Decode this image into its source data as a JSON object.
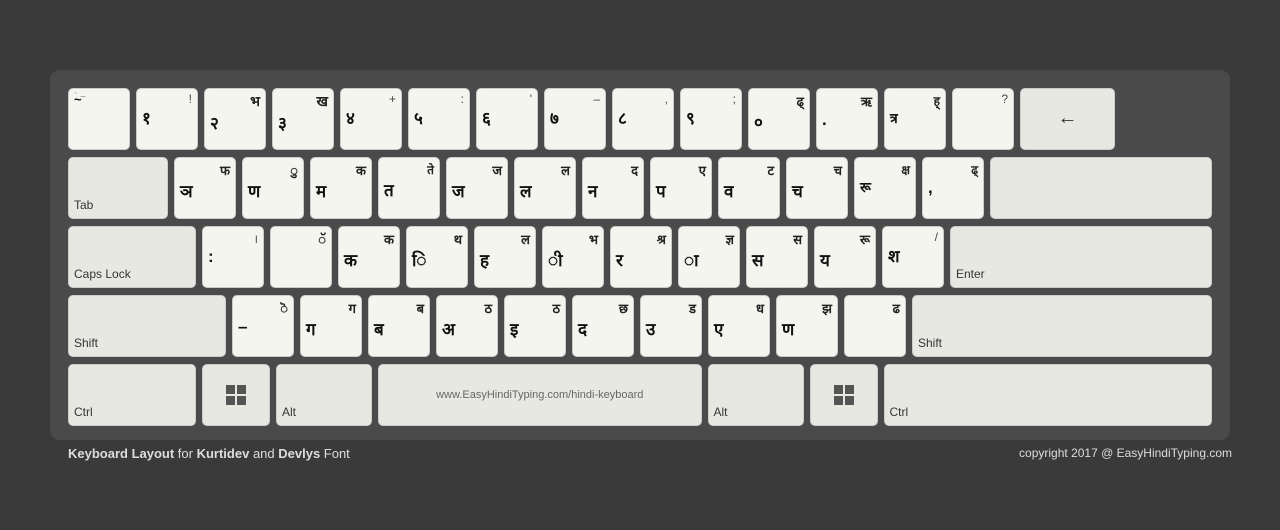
{
  "keyboard": {
    "title": "Keyboard Layout",
    "subtitle_for": "for",
    "font1": "Kurtidev",
    "and": "and",
    "font2": "Devlys",
    "font_label": "Font",
    "copyright": "copyright 2017 @ EasyHindiTyping.com",
    "space_label": "www.EasyHindiTyping.com/hindi-keyboard",
    "rows": [
      {
        "keys": [
          {
            "label": "",
            "top": "",
            "bottom": "~",
            "eng": "` ~",
            "id": "tilde"
          },
          {
            "label": "",
            "top": "!",
            "bottom": "१",
            "eng": "1 !",
            "id": "1"
          },
          {
            "label": "",
            "top": "भ",
            "bottom": "२",
            "eng": "2",
            "id": "2"
          },
          {
            "label": "",
            "top": "ख",
            "bottom": "३",
            "eng": "3",
            "id": "3"
          },
          {
            "label": "",
            "top": "+",
            "bottom": "४",
            "eng": "4",
            "id": "4"
          },
          {
            "label": "",
            "top": ":",
            "bottom": "५",
            "eng": "5",
            "id": "5"
          },
          {
            "label": "",
            "top": "'",
            "bottom": "६",
            "eng": "6",
            "id": "6"
          },
          {
            "label": "",
            "top": "–",
            "bottom": "७",
            "eng": "7",
            "id": "7"
          },
          {
            "label": "",
            "top": ",",
            "bottom": "८",
            "eng": "8",
            "id": "8"
          },
          {
            "label": "",
            "top": ";",
            "bottom": "९",
            "eng": "9",
            "id": "9"
          },
          {
            "label": "",
            "top": "ढ्",
            "bottom": "०",
            "eng": "0",
            "id": "0"
          },
          {
            "label": "",
            "top": "ऋ",
            "bottom": ".",
            "eng": "-",
            "id": "minus"
          },
          {
            "label": "",
            "top": "ह्",
            "bottom": "त्र",
            "eng": "=",
            "id": "equal"
          },
          {
            "label": "",
            "top": "?",
            "bottom": "",
            "eng": "",
            "id": "bracket"
          },
          {
            "label": "←",
            "top": "",
            "bottom": "",
            "eng": "backspace",
            "id": "backspace",
            "special": true
          }
        ]
      },
      {
        "keys": [
          {
            "label": "Tab",
            "top": "",
            "bottom": "",
            "eng": "tab",
            "id": "tab",
            "special": true
          },
          {
            "label": "",
            "top": "फ",
            "bottom": "ञ",
            "eng": "Q",
            "id": "Q"
          },
          {
            "label": "",
            "top": "ु",
            "bottom": "ण",
            "eng": "W",
            "id": "W"
          },
          {
            "label": "",
            "top": "क",
            "bottom": "म",
            "eng": "E",
            "id": "E"
          },
          {
            "label": "",
            "top": "ते",
            "bottom": "त",
            "eng": "R",
            "id": "R"
          },
          {
            "label": "",
            "top": "ज",
            "bottom": "ज",
            "eng": "T",
            "id": "T"
          },
          {
            "label": "",
            "top": "ल",
            "bottom": "ल",
            "eng": "Y",
            "id": "Y"
          },
          {
            "label": "",
            "top": "द",
            "bottom": "न",
            "eng": "U",
            "id": "U"
          },
          {
            "label": "",
            "top": "ए",
            "bottom": "प",
            "eng": "I",
            "id": "I"
          },
          {
            "label": "",
            "top": "ट",
            "bottom": "व",
            "eng": "O",
            "id": "O"
          },
          {
            "label": "",
            "top": "च",
            "bottom": "च",
            "eng": "P",
            "id": "P"
          },
          {
            "label": "",
            "top": "क्ष",
            "bottom": "रू",
            "eng": "[",
            "id": "bracket_l"
          },
          {
            "label": "",
            "top": "ढ्",
            "bottom": ",",
            "eng": "]",
            "id": "bracket_r"
          },
          {
            "label": "",
            "top": "",
            "bottom": "",
            "eng": "\\",
            "id": "backslash",
            "special": true
          }
        ]
      },
      {
        "keys": [
          {
            "label": "Caps Lock",
            "top": "",
            "bottom": "",
            "eng": "capslock",
            "id": "capslock",
            "special": true
          },
          {
            "label": "",
            "top": "।",
            "bottom": ":",
            "eng": "A",
            "id": "A"
          },
          {
            "label": "",
            "top": "ॅ",
            "bottom": "",
            "eng": "S",
            "id": "S"
          },
          {
            "label": "",
            "top": "क",
            "bottom": "क",
            "eng": "D",
            "id": "D"
          },
          {
            "label": "",
            "top": "थ",
            "bottom": "ि",
            "eng": "F",
            "id": "F"
          },
          {
            "label": "",
            "top": "ल",
            "bottom": "ह",
            "eng": "G",
            "id": "G"
          },
          {
            "label": "",
            "top": "भ",
            "bottom": "ी",
            "eng": "H",
            "id": "H"
          },
          {
            "label": "",
            "top": "श्र",
            "bottom": "र",
            "eng": "J",
            "id": "J"
          },
          {
            "label": "",
            "top": "ज्ञ",
            "bottom": "ा",
            "eng": "K",
            "id": "K"
          },
          {
            "label": "",
            "top": "स",
            "bottom": "स",
            "eng": "L",
            "id": "L"
          },
          {
            "label": "",
            "top": "रू",
            "bottom": "य",
            "eng": ";",
            "id": "semicolon"
          },
          {
            "label": "",
            "top": "/",
            "bottom": "श",
            "eng": "'",
            "id": "quote"
          },
          {
            "label": "Enter",
            "top": "",
            "bottom": "",
            "eng": "enter",
            "id": "enter",
            "special": true
          }
        ]
      },
      {
        "keys": [
          {
            "label": "Shift",
            "top": "",
            "bottom": "",
            "eng": "shift_l",
            "id": "shift_l",
            "special": true
          },
          {
            "label": "",
            "top": "ॆ",
            "bottom": "–",
            "eng": "Z",
            "id": "Z"
          },
          {
            "label": "",
            "top": "ग",
            "bottom": "ग",
            "eng": "X",
            "id": "X"
          },
          {
            "label": "",
            "top": "ब",
            "bottom": "ब",
            "eng": "C",
            "id": "C"
          },
          {
            "label": "",
            "top": "ठ",
            "bottom": "अ",
            "eng": "V",
            "id": "V"
          },
          {
            "label": "",
            "top": "ठ",
            "bottom": "इ",
            "eng": "B",
            "id": "B"
          },
          {
            "label": "",
            "top": "छ",
            "bottom": "द",
            "eng": "N",
            "id": "N"
          },
          {
            "label": "",
            "top": "ड",
            "bottom": "उ",
            "eng": "M",
            "id": "M"
          },
          {
            "label": "",
            "top": "ध",
            "bottom": "ए",
            "eng": ",",
            "id": "comma"
          },
          {
            "label": "",
            "top": "झ",
            "bottom": "ण",
            "eng": ".",
            "id": "period"
          },
          {
            "label": "",
            "top": "ढ",
            "bottom": "",
            "eng": "/",
            "id": "slash"
          },
          {
            "label": "Shift",
            "top": "",
            "bottom": "",
            "eng": "shift_r",
            "id": "shift_r",
            "special": true
          }
        ]
      },
      {
        "keys": [
          {
            "label": "Ctrl",
            "top": "",
            "bottom": "",
            "eng": "ctrl_l",
            "id": "ctrl_l",
            "special": true
          },
          {
            "label": "win_l",
            "top": "",
            "bottom": "",
            "eng": "win_l",
            "id": "win_l",
            "special": true,
            "win": true
          },
          {
            "label": "Alt",
            "top": "",
            "bottom": "",
            "eng": "alt_l",
            "id": "alt_l",
            "special": true
          },
          {
            "label": "space",
            "top": "",
            "bottom": "",
            "eng": "space",
            "id": "space",
            "special": true,
            "space": true
          },
          {
            "label": "Alt",
            "top": "",
            "bottom": "",
            "eng": "alt_r",
            "id": "alt_r",
            "special": true
          },
          {
            "label": "win_r",
            "top": "",
            "bottom": "",
            "eng": "win_r",
            "id": "win_r",
            "special": true,
            "win": true
          },
          {
            "label": "Ctrl",
            "top": "",
            "bottom": "",
            "eng": "ctrl_r",
            "id": "ctrl_r",
            "special": true
          }
        ]
      }
    ]
  }
}
